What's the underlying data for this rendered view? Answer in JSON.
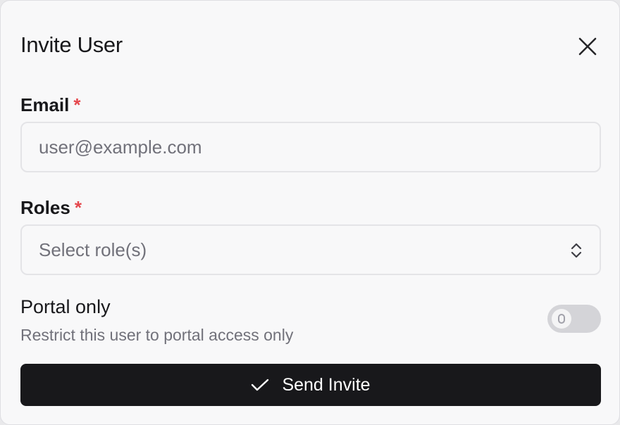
{
  "dialog": {
    "title": "Invite User",
    "close_icon": "close-icon"
  },
  "email": {
    "label": "Email",
    "required_mark": "*",
    "placeholder": "user@example.com",
    "value": ""
  },
  "roles": {
    "label": "Roles",
    "required_mark": "*",
    "selected_text": "Select role(s)",
    "icon": "chevron-up-down-icon"
  },
  "portal_only": {
    "title": "Portal only",
    "description": "Restrict this user to portal access only",
    "enabled": false
  },
  "submit": {
    "label": "Send Invite",
    "icon": "check-icon"
  },
  "colors": {
    "required": "#e5484d",
    "button_bg": "#18181b",
    "dialog_bg": "#f8f8f9",
    "muted_text": "#71717a",
    "toggle_off": "#d4d4d8"
  }
}
